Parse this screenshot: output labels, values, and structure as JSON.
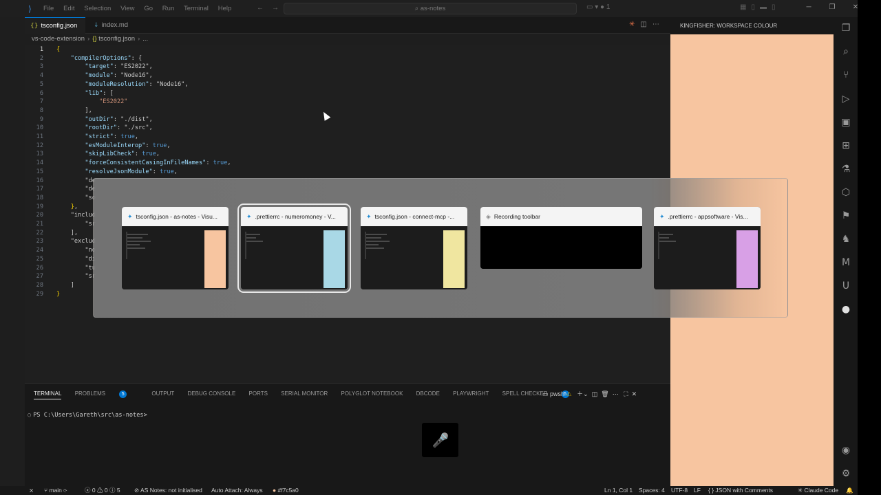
{
  "titlebar": {
    "menu": [
      "File",
      "Edit",
      "Selection",
      "View",
      "Go",
      "Run",
      "Terminal",
      "Help"
    ],
    "search": "as-notes",
    "chat_count": "1"
  },
  "tabs": [
    {
      "label": "tsconfig.json",
      "active": true
    },
    {
      "label": "index.md",
      "active": false
    }
  ],
  "breadcrumb": [
    "vs-code-extension",
    "tsconfig.json",
    "..."
  ],
  "code_lines": [
    "{",
    "    \"compilerOptions\": {",
    "        \"target\": \"ES2022\",",
    "        \"module\": \"Node16\",",
    "        \"moduleResolution\": \"Node16\",",
    "        \"lib\": [",
    "            \"ES2022\"",
    "        ],",
    "        \"outDir\": \"./dist\",",
    "        \"rootDir\": \"./src\",",
    "        \"strict\": true,",
    "        \"esModuleInterop\": true,",
    "        \"skipLibCheck\": true,",
    "        \"forceConsistentCasingInFileNames\": true,",
    "        \"resolveJsonModule\": true,",
    "        \"de",
    "        \"de",
    "        \"so",
    "    },",
    "    \"includ",
    "        \"sr",
    "    ],",
    "    \"exclud",
    "        \"no",
    "        \"di",
    "        \"tu",
    "        \"sr",
    "    ]",
    "}"
  ],
  "right_panel": {
    "title": "KINGFISHER: WORKSPACE COLOUR",
    "colour": "#f7c5a0"
  },
  "panel": {
    "tabs": [
      {
        "label": "TERMINAL",
        "active": true
      },
      {
        "label": "PROBLEMS",
        "badge": "5"
      },
      {
        "label": "OUTPUT"
      },
      {
        "label": "DEBUG CONSOLE"
      },
      {
        "label": "PORTS"
      },
      {
        "label": "SERIAL MONITOR"
      },
      {
        "label": "POLYGLOT NOTEBOOK"
      },
      {
        "label": "DBCODE"
      },
      {
        "label": "PLAYWRIGHT"
      },
      {
        "label": "SPELL CHECKER",
        "badge": "5"
      }
    ],
    "shell": "pwsh",
    "prompt": "PS C:\\Users\\Gareth\\src\\as-notes>"
  },
  "switcher": [
    {
      "title": "tsconfig.json - as-notes - Visu...",
      "swatch": "#f7c5a0",
      "icon": "vscode-icon",
      "selected": false
    },
    {
      "title": ".prettierrc - numeromoney - V...",
      "swatch": "#a9d8e6",
      "icon": "vscode-icon",
      "selected": true
    },
    {
      "title": "tsconfig.json - connect-mcp -...",
      "swatch": "#f0e6a0",
      "icon": "vscode-icon",
      "selected": false
    },
    {
      "title": "Recording toolbar",
      "swatch": "",
      "icon": "recording-icon",
      "selected": false
    },
    {
      "title": ".prettierrc - appsoftware - Vis...",
      "swatch": "#d8a0e6",
      "icon": "vscode-icon",
      "selected": false
    }
  ],
  "statusbar": {
    "branch": "main",
    "errors": "0",
    "warnings": "0",
    "info": "5",
    "as_notes": "AS Notes: not initialised",
    "auto_attach": "Auto Attach: Always",
    "colour": "#f7c5a0",
    "position": "Ln 1, Col 1",
    "spaces": "Spaces: 4",
    "encoding": "UTF-8",
    "eol": "LF",
    "language": "JSON with Comments",
    "claude": "Claude Code"
  }
}
